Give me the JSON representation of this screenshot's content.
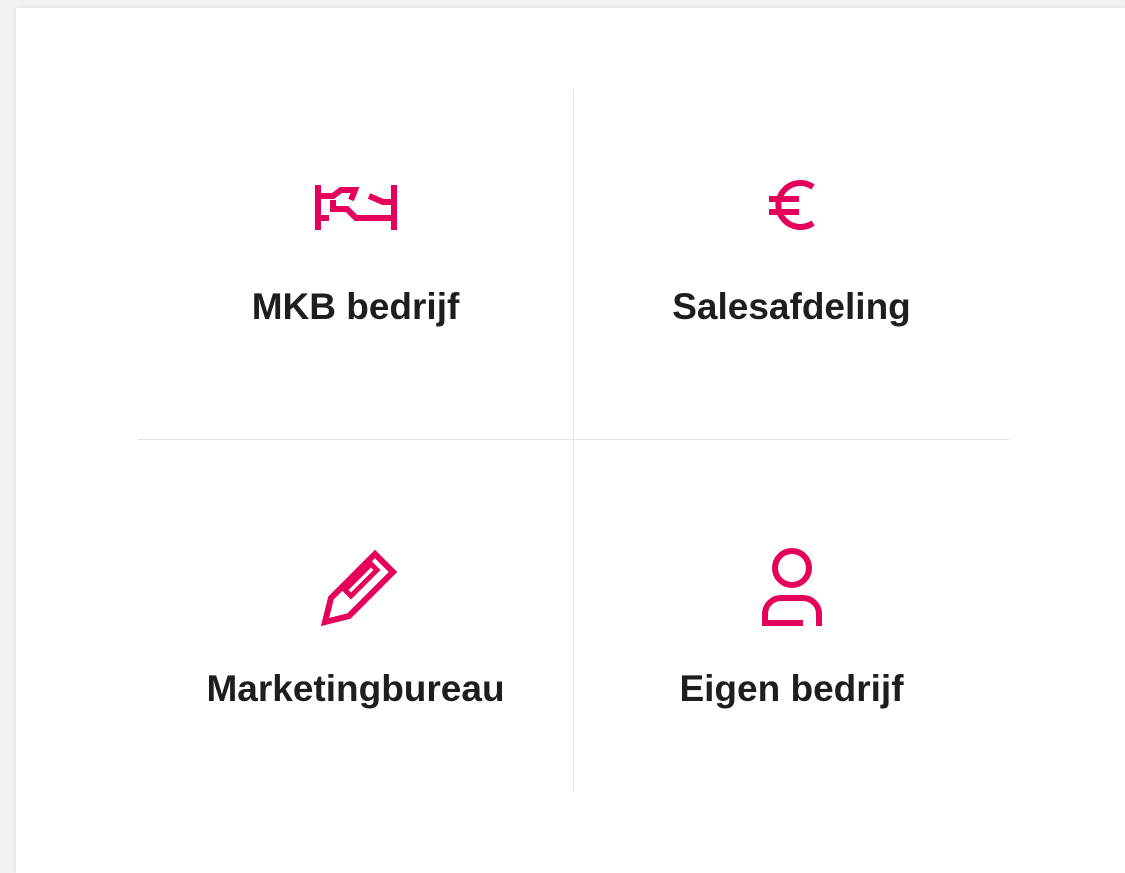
{
  "accent_color": "#e4005b",
  "options": [
    {
      "label": "MKB bedrijf",
      "icon": "handshake-icon"
    },
    {
      "label": "Salesafdeling",
      "icon": "euro-icon"
    },
    {
      "label": "Marketingbureau",
      "icon": "pencil-icon"
    },
    {
      "label": "Eigen bedrijf",
      "icon": "person-icon"
    }
  ]
}
